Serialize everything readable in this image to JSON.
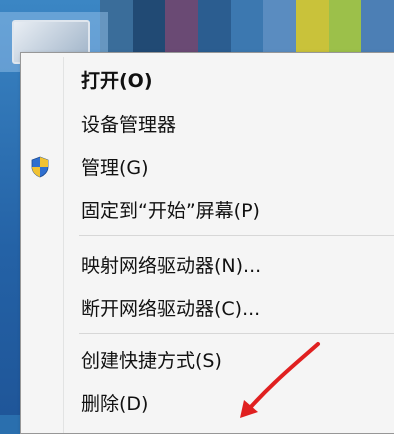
{
  "menu": {
    "items": [
      {
        "label": "打开(O)"
      },
      {
        "label": "设备管理器"
      },
      {
        "label": "管理(G)",
        "icon": "uac-shield-icon"
      },
      {
        "label": "固定到“开始”屏幕(P)"
      },
      {
        "label": "映射网络驱动器(N)..."
      },
      {
        "label": "断开网络驱动器(C)..."
      },
      {
        "label": "创建快捷方式(S)"
      },
      {
        "label": "删除(D)"
      }
    ]
  },
  "colors": {
    "menu_bg": "#f5f5f5",
    "arrow": "#e02020",
    "desktop": "#2a6fae"
  }
}
